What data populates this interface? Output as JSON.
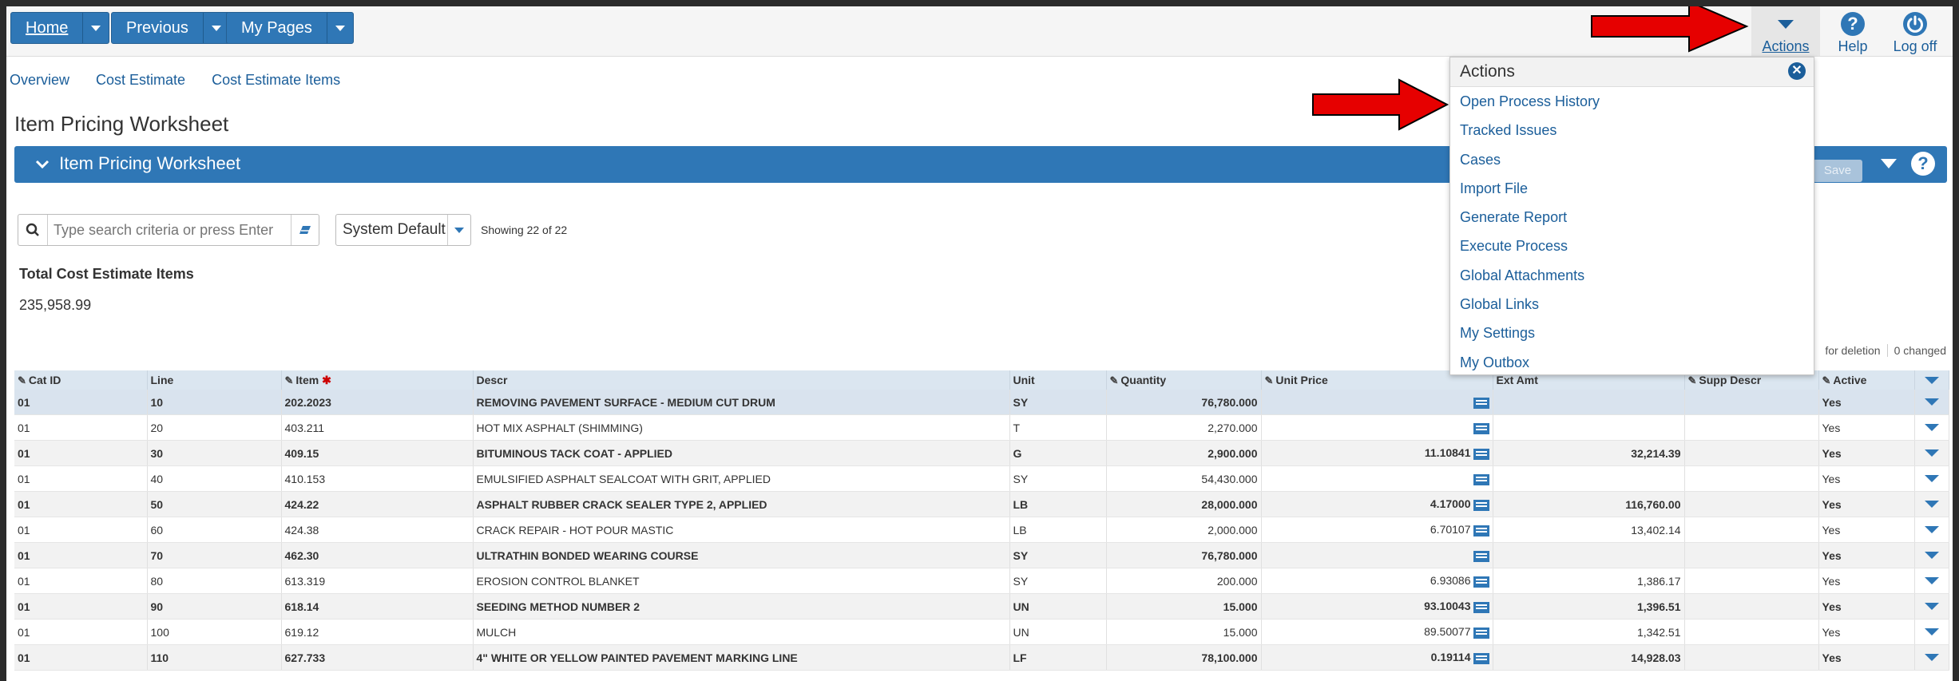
{
  "nav": {
    "home_label": "Home",
    "previous_label": "Previous",
    "mypages_label": "My Pages",
    "actions_label": "Actions",
    "help_label": "Help",
    "logoff_label": "Log off"
  },
  "breadcrumbs": [
    "Overview",
    "Cost Estimate",
    "Cost Estimate Items"
  ],
  "page_title": "Item Pricing Worksheet",
  "panel_title": "Item Pricing Worksheet",
  "save_label": "Save",
  "search": {
    "placeholder": "Type search criteria or press Enter"
  },
  "view_select": {
    "value": "System Default"
  },
  "showing_text": "Showing 22 of 22",
  "totals": {
    "label": "Total Cost Estimate Items",
    "value": "235,958.99"
  },
  "status": {
    "deletion": "for deletion",
    "changed": "0 changed"
  },
  "actions_menu": {
    "title": "Actions",
    "items": [
      "Open Process History",
      "Tracked Issues",
      "Cases",
      "Import File",
      "Generate Report",
      "Execute Process",
      "Global Attachments",
      "Global Links",
      "My Settings",
      "My Outbox"
    ]
  },
  "table": {
    "columns": [
      "Cat ID",
      "Line",
      "Item",
      "Descr",
      "Unit",
      "Quantity",
      "Unit Price",
      "Ext Amt",
      "Supp Descr",
      "Active"
    ],
    "rows": [
      {
        "cat": "01",
        "line": "10",
        "item": "202.2023",
        "descr": "REMOVING PAVEMENT SURFACE - MEDIUM CUT DRUM",
        "unit": "SY",
        "qty": "76,780.000",
        "price": "",
        "ext": "",
        "supp": "",
        "active": "Yes"
      },
      {
        "cat": "01",
        "line": "20",
        "item": "403.211",
        "descr": "HOT MIX ASPHALT (SHIMMING)",
        "unit": "T",
        "qty": "2,270.000",
        "price": "",
        "ext": "",
        "supp": "",
        "active": "Yes"
      },
      {
        "cat": "01",
        "line": "30",
        "item": "409.15",
        "descr": "BITUMINOUS TACK COAT - APPLIED",
        "unit": "G",
        "qty": "2,900.000",
        "price": "11.10841",
        "ext": "32,214.39",
        "supp": "",
        "active": "Yes"
      },
      {
        "cat": "01",
        "line": "40",
        "item": "410.153",
        "descr": "EMULSIFIED ASPHALT SEALCOAT WITH GRIT, APPLIED",
        "unit": "SY",
        "qty": "54,430.000",
        "price": "",
        "ext": "",
        "supp": "",
        "active": "Yes"
      },
      {
        "cat": "01",
        "line": "50",
        "item": "424.22",
        "descr": "ASPHALT RUBBER CRACK SEALER TYPE 2, APPLIED",
        "unit": "LB",
        "qty": "28,000.000",
        "price": "4.17000",
        "ext": "116,760.00",
        "supp": "",
        "active": "Yes"
      },
      {
        "cat": "01",
        "line": "60",
        "item": "424.38",
        "descr": "CRACK REPAIR - HOT POUR MASTIC",
        "unit": "LB",
        "qty": "2,000.000",
        "price": "6.70107",
        "ext": "13,402.14",
        "supp": "",
        "active": "Yes"
      },
      {
        "cat": "01",
        "line": "70",
        "item": "462.30",
        "descr": "ULTRATHIN BONDED WEARING COURSE",
        "unit": "SY",
        "qty": "76,780.000",
        "price": "",
        "ext": "",
        "supp": "",
        "active": "Yes"
      },
      {
        "cat": "01",
        "line": "80",
        "item": "613.319",
        "descr": "EROSION CONTROL BLANKET",
        "unit": "SY",
        "qty": "200.000",
        "price": "6.93086",
        "ext": "1,386.17",
        "supp": "",
        "active": "Yes"
      },
      {
        "cat": "01",
        "line": "90",
        "item": "618.14",
        "descr": "SEEDING METHOD NUMBER 2",
        "unit": "UN",
        "qty": "15.000",
        "price": "93.10043",
        "ext": "1,396.51",
        "supp": "",
        "active": "Yes"
      },
      {
        "cat": "01",
        "line": "100",
        "item": "619.12",
        "descr": "MULCH",
        "unit": "UN",
        "qty": "15.000",
        "price": "89.50077",
        "ext": "1,342.51",
        "supp": "",
        "active": "Yes"
      },
      {
        "cat": "01",
        "line": "110",
        "item": "627.733",
        "descr": "4\" WHITE OR YELLOW PAINTED PAVEMENT MARKING LINE",
        "unit": "LF",
        "qty": "78,100.000",
        "price": "0.19114",
        "ext": "14,928.03",
        "supp": "",
        "active": "Yes"
      }
    ]
  },
  "colors": {
    "accent": "#2f77b6",
    "link": "#1b5e9a",
    "arrow": "#e60000"
  }
}
